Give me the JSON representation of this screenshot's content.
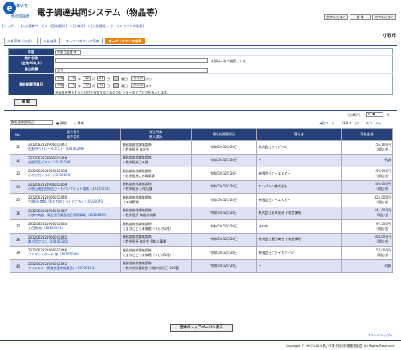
{
  "header": {
    "logo_text": "e",
    "logo_name1": "あいち",
    "logo_name2": "物品等調達",
    "title": "電子調達共同システム（物品等）",
    "buttons": [
      "文字を大きく",
      "標 準",
      "文字を小さく"
    ]
  },
  "breadcrumb": [
    "[トップ]",
    "> [入札情報サービス（団体選択）]",
    "> [小牧市]",
    "> [入札情報 > オープンカウンタ結果]"
  ],
  "city": "小牧市",
  "tabs": [
    "入札案件（公告）",
    "入札結果",
    "オープンカウンタ案件",
    "オープンカウンタ結果"
  ],
  "search": {
    "year_label": "年度",
    "year_value": "令和 5年度 ▼",
    "name_label1": "案件名称",
    "name_label2": "（全角50文字）",
    "name_note": "※部分一致で検索します。",
    "type_label": "発注所属",
    "type_value": "全て",
    "date_label": "開札結果登録日",
    "from": {
      "era": "令和",
      "year": "5",
      "month": "12",
      "day": "21",
      "suffix": "曜日",
      "clear": "クリア",
      "kara": "から"
    },
    "to": {
      "era": "令和",
      "year": "5",
      "month": "12",
      "day": "28",
      "suffix": "曜日",
      "clear": "クリア",
      "made": "まで"
    },
    "calendar_note": "※画像を押下すると日付を指定するためのカレンダーダイアログを表示します。",
    "search_button": "検 索"
  },
  "results_info": {
    "count": "（全45件）",
    "per_page": "10 ▼",
    "per_page_label": "件",
    "sort_value": "開札結果登録日",
    "radio_asc": "昇順",
    "radio_desc": "降順",
    "prev": "前ページ",
    "page": "（1/5ページ）",
    "next": "次ページ"
  },
  "table": {
    "headers": {
      "no": "No.",
      "name1": "案件番号",
      "name2": "案件名称",
      "dept1": "発注所属",
      "dept2": "納入場所",
      "date": "開札結果登録日",
      "winner": "落札者",
      "amount": "落札金額"
    },
    "rows": [
      {
        "no": "31",
        "id": "2312062321906015447",
        "name": "長野市パトロールポスト（10105249）",
        "dept": "総務部庶務課施設係",
        "place": "小牧市役所 本庁舎",
        "date": "令和 5年12月28日",
        "winner": "株式会社アイデアム",
        "amount": "156,100円",
        "tax": "（税抜き）"
      },
      {
        "no": "32",
        "id": "2312062321906015448",
        "name": "衣服用品パネル（10105189）",
        "dept": "総務部庶務課施設係",
        "place": "小牧市役所ごみ課",
        "date": "令和 5年12月28日",
        "winner": "ー",
        "amount": "不調",
        "tax": ""
      },
      {
        "no": "33",
        "id": "2312062321906015038",
        "name": "ごみ分別チラシ（10105056）",
        "dept": "総務部庶務課施設係",
        "place": "小牧市役所ごみ政策課",
        "date": "令和 5年12月28日",
        "winner": "有限会社オーエスピー",
        "amount": "190,000円",
        "tax": "（税抜き）"
      },
      {
        "no": "34",
        "id": "2312062321906015059",
        "name": "小牧山城歴史探訪ガイドパンフレット増刷（10105054）",
        "dept": "総務部庶務課施設係",
        "place": "小牧市役所 小牧山課",
        "date": "令和 5年12月28日",
        "winner": "サンプラス株式会社",
        "amount": "200,000円",
        "tax": "（税抜き）"
      },
      {
        "no": "35",
        "id": "2312062321906015040",
        "name": "令和6年度版「私たちのくらしとごみ」（10105070）",
        "dept": "総務部庶務課施設係",
        "place": "ごみ政策課",
        "date": "令和 5年12月28日",
        "winner": "有限会社オーエスピー",
        "amount": "425,000円",
        "tax": "（税抜き）"
      },
      {
        "no": "36",
        "id": "2312062321906015047",
        "name": "小牧市陶器・衛生週刊薬品地区利用事業（10104889）",
        "dept": "総務部庶務課施設係",
        "place": "小牧市役所 陶器化学課",
        "date": "令和 5年12月28日",
        "winner": "株式会社東海化研 小牧営業所",
        "amount": "541,000円",
        "tax": "（税抜き）"
      },
      {
        "no": "37",
        "id": "2312062321906015044",
        "name": "五色桶 他（10105041）",
        "dept": "総務部庶務課施設係",
        "place": "こまきこども未来館（ラビオ1階）",
        "date": "令和 5年12月28日",
        "winner": "みわや",
        "amount": "97,500円",
        "tax": "（税抜き）"
      },
      {
        "no": "38",
        "id": "2312062321906015045",
        "name": "職人用ワゴン（10105181）",
        "dept": "総務部庶務課施設係",
        "place": "小牧市役所 本庁舎 6階 人事課",
        "date": "令和 5年12月28日",
        "winner": "株式会社豊田商会 小牧営業所",
        "amount": "504,000円",
        "tax": "（税抜き）"
      },
      {
        "no": "39",
        "id": "2312062321906015046",
        "name": "ゴムマットボード 他（10105048）",
        "dept": "総務部庶務課施設係",
        "place": "こまきこども未来館（ラビオ1階）",
        "date": "令和 5年12月28日",
        "winner": "有限会社ナガイスポーツ",
        "amount": "57,000円",
        "tax": "（税抜き）"
      },
      {
        "no": "40",
        "id": "2312062321906015043",
        "name": "アイジエル（異度性薬剤保管品）（10105153）",
        "dept": "総務部庶務課施設係",
        "place": "小牧市消防署救急 小牧市役所日 119番",
        "date": "令和 5年12月28日",
        "winner": "ー",
        "amount": "不調",
        "tax": ""
      }
    ]
  },
  "bottom_button": "団体のトップページへ戻る",
  "top_link": "↑ページトップへ",
  "copyright": "Copyright © 2007-2024 あいち電子自治体推進協議会. All Rights Reserved."
}
